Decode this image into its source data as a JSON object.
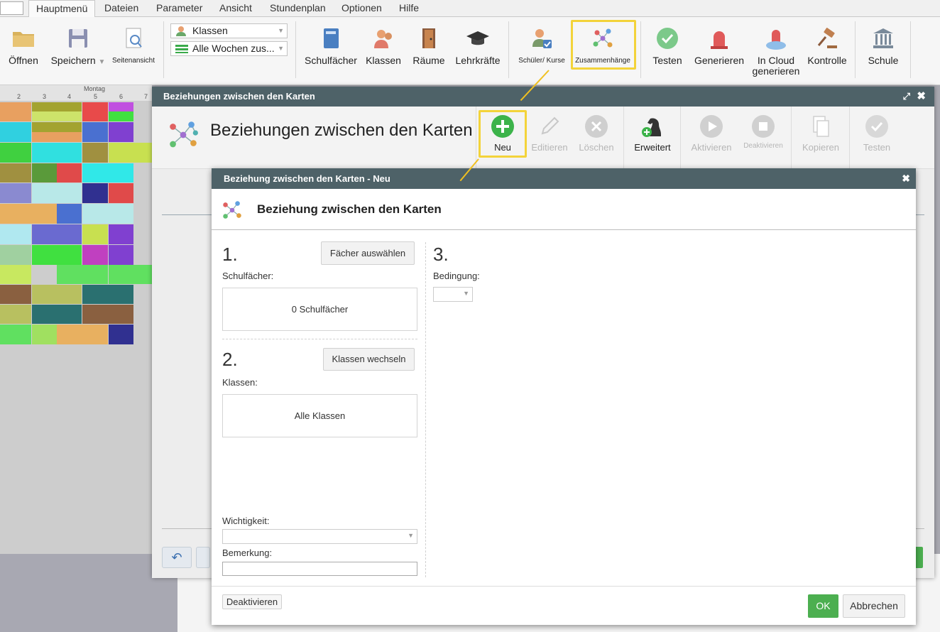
{
  "menubar": {
    "tabs": [
      "Hauptmenü",
      "Dateien",
      "Parameter",
      "Ansicht",
      "Stundenplan",
      "Optionen",
      "Hilfe"
    ]
  },
  "ribbon": {
    "open": "Öffnen",
    "save": "Speichern",
    "page_view": "Seitenansicht",
    "dropdown_classes": "Klassen",
    "dropdown_weeks": "Alle Wochen zus...",
    "subjects": "Schulfächer",
    "classes": "Klassen",
    "rooms": "Räume",
    "teachers": "Lehrkräfte",
    "students_courses": "Schüler/ Kurse",
    "relations": "Zusammenhänge",
    "test": "Testen",
    "generate": "Generieren",
    "cloud_generate_1": "In Cloud",
    "cloud_generate_2": "generieren",
    "control": "Kontrolle",
    "school": "Schule"
  },
  "timetable": {
    "day": "Montag",
    "col_numbers": [
      "2",
      "3",
      "4",
      "5",
      "6",
      "7"
    ]
  },
  "dialog1": {
    "title": "Beziehungen zwischen den Karten",
    "heading": "Beziehungen zwischen den Karten",
    "toolbar": {
      "new": "Neu",
      "edit": "Editieren",
      "delete": "Löschen",
      "advanced": "Erweitert",
      "activate": "Aktivieren",
      "deactivate": "Deaktivieren",
      "copy": "Kopieren",
      "test": "Testen"
    }
  },
  "dialog2": {
    "title": "Beziehung zwischen den Karten - Neu",
    "heading": "Beziehung zwischen den Karten",
    "step1": "1.",
    "step2": "2.",
    "step3": "3.",
    "select_subjects_btn": "Fächer auswählen",
    "subjects_label": "Schulfächer:",
    "subjects_value": "0 Schulfächer",
    "change_classes_btn": "Klassen wechseln",
    "classes_label": "Klassen:",
    "classes_value": "Alle Klassen",
    "importance_label": "Wichtigkeit:",
    "note_label": "Bemerkung:",
    "condition_label": "Bedingung:",
    "deactivate_btn": "Deaktivieren",
    "ok_btn": "OK",
    "cancel_btn": "Abbrechen"
  },
  "colors": {
    "titlebar": "#4e6268",
    "highlight": "#f3d33a",
    "ok_green": "#4caf50"
  }
}
